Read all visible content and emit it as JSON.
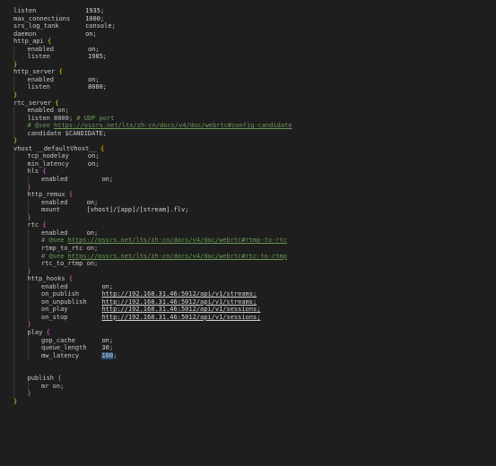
{
  "lines": [
    {
      "indent": 0,
      "tokens": [
        {
          "t": "listen",
          "c": "k"
        },
        {
          "t": "             1935;",
          "c": "s"
        }
      ]
    },
    {
      "indent": 0,
      "tokens": [
        {
          "t": "max_connections",
          "c": "k"
        },
        {
          "t": "    1000;",
          "c": "s"
        }
      ]
    },
    {
      "indent": 0,
      "tokens": [
        {
          "t": "srs_log_tank",
          "c": "k"
        },
        {
          "t": "       console;",
          "c": "s"
        }
      ]
    },
    {
      "indent": 0,
      "tokens": [
        {
          "t": "daemon",
          "c": "k"
        },
        {
          "t": "             on;",
          "c": "s"
        }
      ]
    },
    {
      "indent": 0,
      "tokens": [
        {
          "t": "http_api ",
          "c": "k"
        },
        {
          "t": "{",
          "c": "b"
        }
      ]
    },
    {
      "indent": 1,
      "tokens": [
        {
          "t": "enabled",
          "c": "k"
        },
        {
          "t": "         on;",
          "c": "s"
        }
      ]
    },
    {
      "indent": 1,
      "tokens": [
        {
          "t": "listen",
          "c": "k"
        },
        {
          "t": "          1985;",
          "c": "s"
        }
      ]
    },
    {
      "indent": 0,
      "tokens": [
        {
          "t": "}",
          "c": "b"
        }
      ]
    },
    {
      "indent": 0,
      "tokens": [
        {
          "t": "http_server ",
          "c": "k"
        },
        {
          "t": "{",
          "c": "b"
        }
      ]
    },
    {
      "indent": 1,
      "tokens": [
        {
          "t": "enabled",
          "c": "k"
        },
        {
          "t": "         on;",
          "c": "s"
        }
      ]
    },
    {
      "indent": 1,
      "tokens": [
        {
          "t": "listen",
          "c": "k"
        },
        {
          "t": "          8080;",
          "c": "s"
        }
      ]
    },
    {
      "indent": 0,
      "tokens": [
        {
          "t": "}",
          "c": "b"
        }
      ]
    },
    {
      "indent": 0,
      "tokens": [
        {
          "t": "rtc_server ",
          "c": "k"
        },
        {
          "t": "{",
          "c": "b"
        }
      ]
    },
    {
      "indent": 1,
      "tokens": [
        {
          "t": "enabled on;",
          "c": "k"
        }
      ]
    },
    {
      "indent": 1,
      "tokens": [
        {
          "t": "listen 8000; ",
          "c": "k"
        },
        {
          "t": "# UDP port",
          "c": "c"
        }
      ]
    },
    {
      "indent": 1,
      "tokens": [
        {
          "t": "# @see ",
          "c": "c"
        },
        {
          "t": "https://ossrs.net/lts/zh-cn/docs/v4/doc/webrtc#config-candidate",
          "c": "u"
        }
      ]
    },
    {
      "indent": 1,
      "tokens": [
        {
          "t": "candidate $CANDIDATE;",
          "c": "k"
        }
      ]
    },
    {
      "indent": 0,
      "tokens": [
        {
          "t": "}",
          "c": "b"
        }
      ]
    },
    {
      "indent": 0,
      "tokens": [
        {
          "t": "vhost __defaultVhost__ ",
          "c": "k"
        },
        {
          "t": "{",
          "c": "b"
        }
      ]
    },
    {
      "indent": 1,
      "tokens": [
        {
          "t": "tcp_nodelay",
          "c": "k"
        },
        {
          "t": "     on;",
          "c": "s"
        }
      ]
    },
    {
      "indent": 1,
      "tokens": [
        {
          "t": "min_latency",
          "c": "k"
        },
        {
          "t": "     on;",
          "c": "s"
        }
      ]
    },
    {
      "indent": 1,
      "tokens": [
        {
          "t": "hls ",
          "c": "k"
        },
        {
          "t": "{",
          "c": "b2"
        }
      ]
    },
    {
      "indent": 2,
      "tokens": [
        {
          "t": "enabled",
          "c": "k"
        },
        {
          "t": "         on;",
          "c": "s"
        }
      ]
    },
    {
      "indent": 1,
      "tokens": [
        {
          "t": "}",
          "c": "b2"
        }
      ]
    },
    {
      "indent": 1,
      "tokens": [
        {
          "t": "http_remux ",
          "c": "k"
        },
        {
          "t": "{",
          "c": "b2"
        }
      ]
    },
    {
      "indent": 2,
      "tokens": [
        {
          "t": "enabled",
          "c": "k"
        },
        {
          "t": "     on;",
          "c": "s"
        }
      ]
    },
    {
      "indent": 2,
      "tokens": [
        {
          "t": "mount",
          "c": "k"
        },
        {
          "t": "       [vhost]/[app]/[stream].flv;",
          "c": "s"
        }
      ]
    },
    {
      "indent": 1,
      "tokens": [
        {
          "t": "}",
          "c": "b2"
        }
      ]
    },
    {
      "indent": 1,
      "tokens": [
        {
          "t": "rtc ",
          "c": "k"
        },
        {
          "t": "{",
          "c": "b2"
        }
      ]
    },
    {
      "indent": 2,
      "tokens": [
        {
          "t": "enabled",
          "c": "k"
        },
        {
          "t": "     on;",
          "c": "s"
        }
      ]
    },
    {
      "indent": 2,
      "tokens": [
        {
          "t": "# @see ",
          "c": "c"
        },
        {
          "t": "https://ossrs.net/lts/zh-cn/docs/v4/doc/webrtc#rtmp-to-rtc",
          "c": "u"
        }
      ]
    },
    {
      "indent": 2,
      "tokens": [
        {
          "t": "rtmp_to_rtc on;",
          "c": "k"
        }
      ]
    },
    {
      "indent": 2,
      "tokens": [
        {
          "t": "# @see ",
          "c": "c"
        },
        {
          "t": "https://ossrs.net/lts/zh-cn/docs/v4/doc/webrtc#rtc-to-rtmp",
          "c": "u"
        }
      ]
    },
    {
      "indent": 2,
      "tokens": [
        {
          "t": "rtc_to_rtmp on;",
          "c": "k"
        }
      ]
    },
    {
      "indent": 1,
      "tokens": [
        {
          "t": "}",
          "c": "b2"
        }
      ]
    },
    {
      "indent": 1,
      "tokens": [
        {
          "t": "http_hooks ",
          "c": "k"
        },
        {
          "t": "{",
          "c": "b2"
        }
      ]
    },
    {
      "indent": 2,
      "tokens": [
        {
          "t": "enabled",
          "c": "k"
        },
        {
          "t": "         on;",
          "c": "s"
        }
      ]
    },
    {
      "indent": 2,
      "tokens": [
        {
          "t": "on_publish",
          "c": "k"
        },
        {
          "t": "      ",
          "c": "s"
        },
        {
          "t": "http://192.168.31.46:5012/api/v1/streams;",
          "c": "l"
        }
      ]
    },
    {
      "indent": 2,
      "tokens": [
        {
          "t": "on_unpublish",
          "c": "k"
        },
        {
          "t": "    ",
          "c": "s"
        },
        {
          "t": "http://192.168.31.46:5012/api/v1/streams;",
          "c": "l"
        }
      ]
    },
    {
      "indent": 2,
      "tokens": [
        {
          "t": "on_play",
          "c": "k"
        },
        {
          "t": "         ",
          "c": "s"
        },
        {
          "t": "http://192.168.31.46:5012/api/v1/sessions;",
          "c": "l"
        }
      ]
    },
    {
      "indent": 2,
      "tokens": [
        {
          "t": "on_stop",
          "c": "k"
        },
        {
          "t": "         ",
          "c": "s"
        },
        {
          "t": "http://192.168.31.46:5012/api/v1/sessions;",
          "c": "l"
        }
      ]
    },
    {
      "indent": 1,
      "tokens": [
        {
          "t": "}",
          "c": "b2"
        }
      ]
    },
    {
      "indent": 1,
      "tokens": [
        {
          "t": "play ",
          "c": "k"
        },
        {
          "t": "{",
          "c": "b2"
        }
      ]
    },
    {
      "indent": 2,
      "tokens": [
        {
          "t": "gop_cache",
          "c": "k"
        },
        {
          "t": "       on;",
          "c": "s"
        }
      ]
    },
    {
      "indent": 2,
      "tokens": [
        {
          "t": "queue_length",
          "c": "k"
        },
        {
          "t": "    30;",
          "c": "s"
        }
      ]
    },
    {
      "indent": 2,
      "tokens": [
        {
          "t": "mw_latency",
          "c": "k"
        },
        {
          "t": "      ",
          "c": "s"
        },
        {
          "t": "100",
          "c": "sel"
        },
        {
          "t": ";",
          "c": "s"
        }
      ]
    },
    {
      "indent": 1,
      "tokens": [
        {
          "t": "",
          "c": "s"
        }
      ]
    },
    {
      "indent": 1,
      "tokens": [
        {
          "t": "",
          "c": "s"
        }
      ]
    },
    {
      "indent": 1,
      "tokens": [
        {
          "t": "publish ",
          "c": "k"
        },
        {
          "t": "{",
          "c": "b2"
        }
      ]
    },
    {
      "indent": 2,
      "tokens": [
        {
          "t": "mr on;",
          "c": "k"
        }
      ]
    },
    {
      "indent": 1,
      "tokens": [
        {
          "t": "}",
          "c": "b2"
        }
      ]
    },
    {
      "indent": 0,
      "tokens": [
        {
          "t": "}",
          "c": "b"
        }
      ]
    }
  ]
}
